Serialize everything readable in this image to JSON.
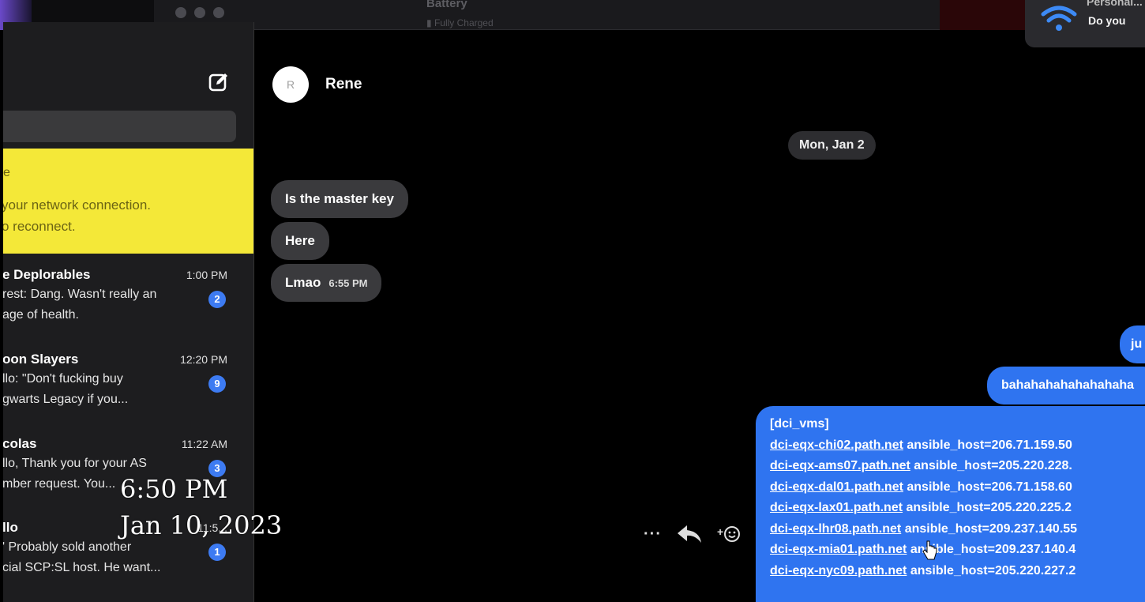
{
  "menubar": {
    "battery_title": "Battery",
    "battery_status": "Fully Charged"
  },
  "notification": {
    "title": "Personal...",
    "body": "Do you"
  },
  "sidebar": {
    "banner": {
      "line1": "e",
      "line2": "your network connection.",
      "line3": "o reconnect."
    },
    "conversations": [
      {
        "name": "e Deplorables",
        "time": "1:00 PM",
        "line1": "rest: Dang. Wasn't really an",
        "line2": "age of health.",
        "badge": "2"
      },
      {
        "name": "oon Slayers",
        "time": "12:20 PM",
        "line1": "llo: \"Don't fucking buy",
        "line2": "gwarts Legacy if you...",
        "badge": "9"
      },
      {
        "name": "colas",
        "time": "11:22 AM",
        "line1": "llo, Thank you for your AS",
        "line2": "mber request. You...",
        "badge": "3"
      },
      {
        "name": "llo",
        "time": "11:5...",
        "line1": "' Probably sold another",
        "line2": "cial SCP:SL host. He want...",
        "badge": "1"
      }
    ]
  },
  "chat": {
    "contact_initial": "R",
    "contact_name": "Rene",
    "date_separator": "Mon, Jan 2",
    "incoming": [
      {
        "text": "Is the master key"
      },
      {
        "text": "Here"
      },
      {
        "text": "Lmao",
        "time": "6:55 PM"
      }
    ],
    "outgoing_short": "ju",
    "outgoing_laugh": "bahahahahahahahaha",
    "code_header": "[dci_vms]",
    "code_lines": [
      {
        "host": "dci-eqx-chi02.path.net",
        "rest": " ansible_host=206.71.159.50"
      },
      {
        "host": "dci-eqx-ams07.path.net",
        "rest": " ansible_host=205.220.228."
      },
      {
        "host": "dci-eqx-dal01.path.net",
        "rest": " ansible_host=206.71.158.60"
      },
      {
        "host": "dci-eqx-lax01.path.net",
        "rest": " ansible_host=205.220.225.2"
      },
      {
        "host": "dci-eqx-lhr08.path.net",
        "rest": " ansible_host=209.237.140.55"
      },
      {
        "host": "dci-eqx-mia01.path.net",
        "rest": " ansible_host=209.237.140.4"
      },
      {
        "host": "dci-eqx-nyc09.path.net",
        "rest": " ansible_host=205.220.227.2"
      }
    ],
    "actions": {
      "more": "···"
    }
  },
  "overlay": {
    "time": "6:50 PM",
    "date": "Jan 10, 2023"
  }
}
